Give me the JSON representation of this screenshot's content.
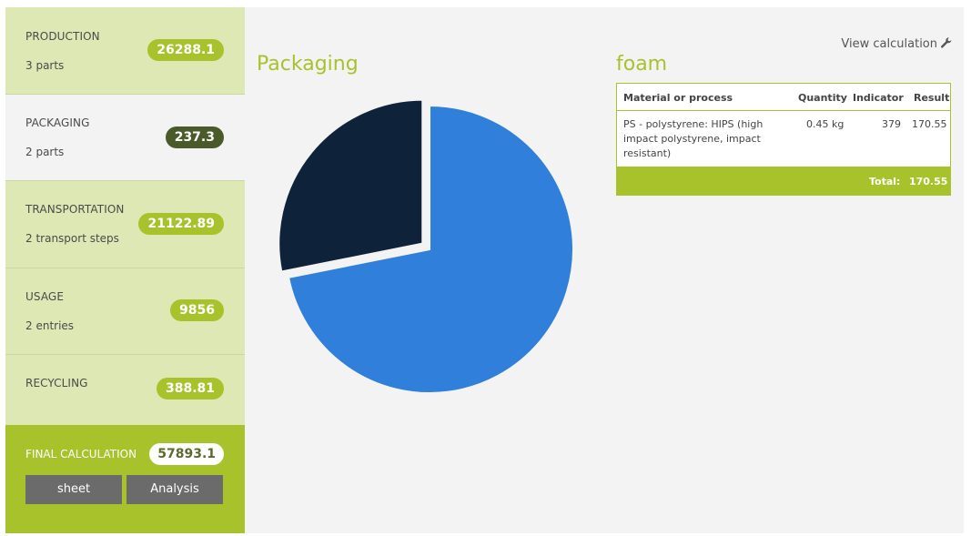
{
  "sidebar": {
    "sections": [
      {
        "title": "PRODUCTION",
        "subtitle": "3 parts",
        "value": "26288.1"
      },
      {
        "title": "PACKAGING",
        "subtitle": "2 parts",
        "value": "237.3"
      },
      {
        "title": "TRANSPORTATION",
        "subtitle": "2 transport steps",
        "value": "21122.89"
      },
      {
        "title": "USAGE",
        "subtitle": "2 entries",
        "value": "9856"
      },
      {
        "title": "RECYCLING",
        "subtitle": "",
        "value": "388.81"
      }
    ],
    "final": {
      "title": "FINAL CALCULATION",
      "value": "57893.1",
      "sheet_label": "sheet",
      "analysis_label": "Analysis"
    }
  },
  "main": {
    "section_title": "Packaging",
    "detail_title": "foam",
    "view_calculation_label": "View calculation",
    "table": {
      "headers": [
        "Material or process",
        "Quantity",
        "Indicator",
        "Result"
      ],
      "rows": [
        {
          "material": "PS - polystyrene: HIPS (high impact polystyrene, impact resistant)",
          "quantity": "0.45 kg",
          "indicator": "379",
          "result": "170.55"
        }
      ],
      "total_label": "Total:",
      "total_value": "170.55"
    }
  },
  "chart_data": {
    "type": "pie",
    "slices": [
      {
        "value": 170.55,
        "color": "#2f7fdb",
        "exploded": false
      },
      {
        "value": 66.75,
        "color": "#0e223a",
        "exploded": true
      }
    ]
  },
  "colors": {
    "accent": "#a8c22c",
    "light_card": "#dde8b4",
    "dark_badge": "#4a5a2a",
    "button": "#6b6b6b"
  }
}
